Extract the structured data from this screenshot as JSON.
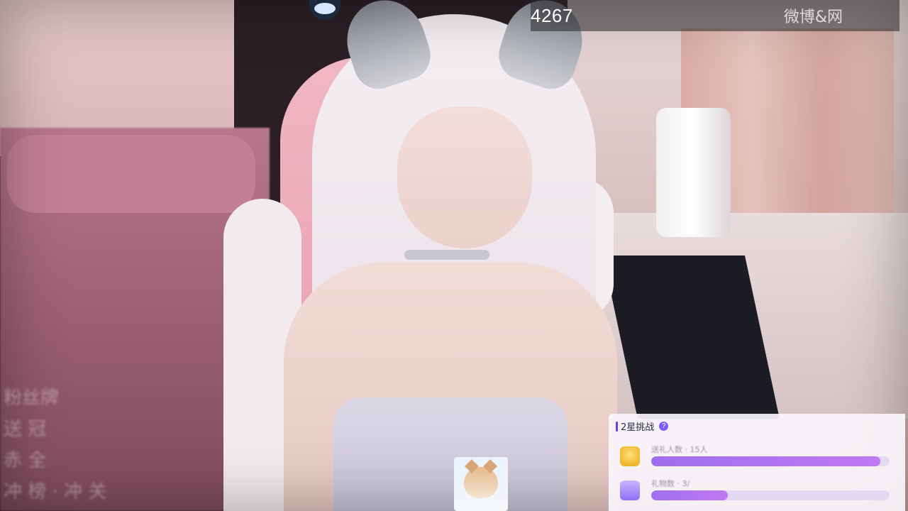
{
  "stream": {
    "viewer_count": "4267",
    "weibo_text": "微博&网"
  },
  "overlay_lines": [
    "粉丝牌",
    "送 冠",
    "赤 全",
    "冲 榜 · 冲 关"
  ],
  "challenge": {
    "title": "2星挑战",
    "help": "?",
    "goals": [
      {
        "label": "送礼人数 · 15人",
        "icon": "trophy-icon",
        "progress": 0.96
      },
      {
        "label": "礼物数 · 3/",
        "icon": "gift-icon",
        "progress": 0.32
      }
    ]
  },
  "colors": {
    "accent": "#7a5ef5",
    "progress_fill": "#b07af1",
    "panel_bg": "#faf6fc"
  }
}
